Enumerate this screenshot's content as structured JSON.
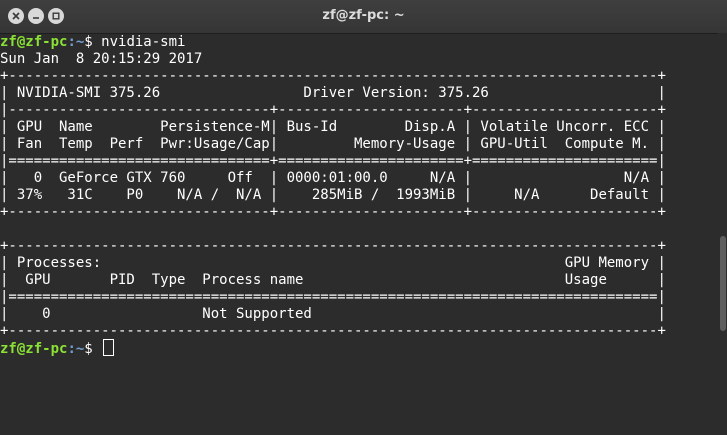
{
  "window": {
    "title": "zf@zf-pc: ~"
  },
  "terminal": {
    "prompt1": {
      "user_host": "zf@zf-pc",
      "path": ":~",
      "symbol": "$",
      "command": " nvidia-smi"
    },
    "lines": [
      "Sun Jan  8 20:15:29 2017",
      "+-----------------------------------------------------------------------------+",
      "| NVIDIA-SMI 375.26                 Driver Version: 375.26                    |",
      "|-------------------------------+----------------------+----------------------+",
      "| GPU  Name        Persistence-M| Bus-Id        Disp.A | Volatile Uncorr. ECC |",
      "| Fan  Temp  Perf  Pwr:Usage/Cap|         Memory-Usage | GPU-Util  Compute M. |",
      "|===============================+======================+======================|",
      "|   0  GeForce GTX 760     Off  | 0000:01:00.0     N/A |                  N/A |",
      "| 37%   31C    P0    N/A /  N/A |    285MiB /  1993MiB |     N/A      Default |",
      "+-------------------------------+----------------------+----------------------+",
      "",
      "+-----------------------------------------------------------------------------+",
      "| Processes:                                                       GPU Memory |",
      "|  GPU       PID  Type  Process name                               Usage      |",
      "|=============================================================================|",
      "|    0                  Not Supported                                         |",
      "+-----------------------------------------------------------------------------+"
    ],
    "prompt2": {
      "user_host": "zf@zf-pc",
      "path": ":~",
      "symbol": "$",
      "command": " "
    }
  },
  "colors": {
    "background": "#2c2c2c",
    "prompt_user": "#8ae234",
    "prompt_path": "#729fcf",
    "text": "#ffffff"
  },
  "icons": [
    "close-icon",
    "minimize-icon",
    "maximize-icon"
  ]
}
